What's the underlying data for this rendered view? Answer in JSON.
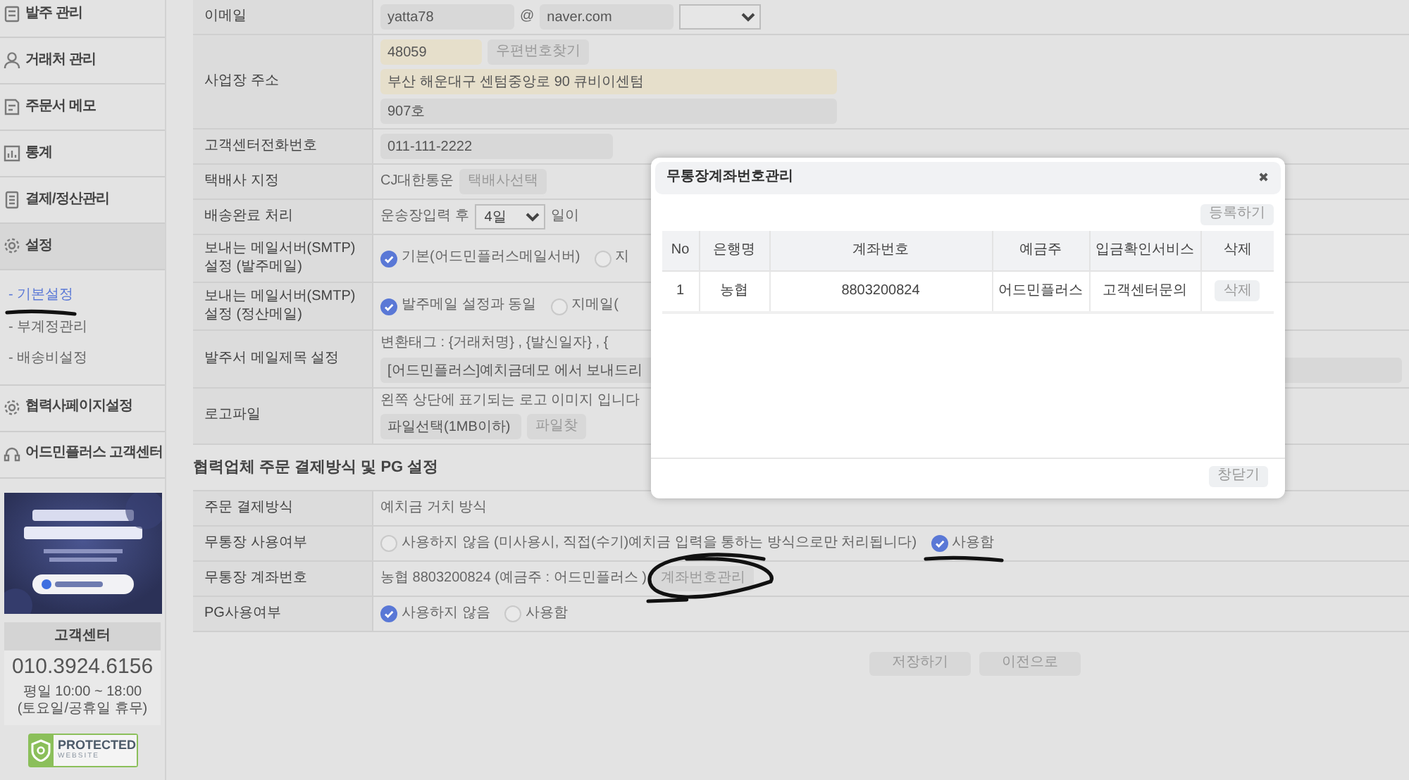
{
  "sidebar": {
    "menu": [
      {
        "label": "발주 관리",
        "expanded": false
      },
      {
        "label": "거래처 관리",
        "expanded": false
      },
      {
        "label": "주문서 메모",
        "expanded": false
      },
      {
        "label": "통계",
        "expanded": false
      },
      {
        "label": "결제/정산관리",
        "expanded": false
      },
      {
        "label": "설정",
        "expanded": true,
        "children": [
          {
            "label": "- 기본설정",
            "selected": true,
            "underlined": true
          },
          {
            "label": "- 부계정관리",
            "selected": false
          },
          {
            "label": "- 배송비설정",
            "selected": false
          }
        ]
      },
      {
        "label": "협력사페이지설정",
        "expanded": false
      },
      {
        "label": "어드민플러스 고객센터",
        "expanded": false
      }
    ],
    "support": {
      "title": "고객센터",
      "phone": "010.3924.6156",
      "hours": "평일 10:00 ~ 18:00",
      "note": "(토요일/공휴일 휴무)"
    },
    "badge": {
      "title": "PROTECTED",
      "subtitle": "WEBSITE"
    }
  },
  "form": {
    "rows": [
      {
        "label": "이메일",
        "lines": [
          [
            {
              "kind": "input",
              "value": "yatta78",
              "highlighted": false
            },
            {
              "kind": "text",
              "text": "@"
            },
            {
              "kind": "input",
              "value": "naver.com",
              "highlighted": false
            },
            {
              "kind": "select"
            }
          ]
        ]
      },
      {
        "label": "사업장 주소",
        "lines": [
          [
            {
              "kind": "input",
              "value": "48059",
              "highlighted": true
            },
            {
              "kind": "button",
              "label": "우편번호찾기"
            }
          ],
          [
            {
              "kind": "input",
              "value": "부산 해운대구 센텀중앙로 90 큐비이센텀",
              "highlighted": true
            }
          ],
          [
            {
              "kind": "input",
              "value": "907호",
              "highlighted": false
            }
          ]
        ]
      },
      {
        "label": "고객센터전화번호",
        "lines": [
          [
            {
              "kind": "input",
              "value": "011-111-2222",
              "highlighted": false
            }
          ]
        ]
      },
      {
        "label": "택배사 지정",
        "lines": [
          [
            {
              "kind": "text",
              "text": "CJ대한통운"
            },
            {
              "kind": "button",
              "label": "택배사선택"
            }
          ]
        ]
      },
      {
        "label": "배송완료 처리",
        "lines": [
          [
            {
              "kind": "text",
              "text": "운송장입력 후"
            },
            {
              "kind": "select",
              "value": "4일"
            },
            {
              "kind": "text",
              "text": "일이"
            }
          ]
        ]
      },
      {
        "label": "보내는 메일서버(SMTP) 설정 (발주메일)",
        "lines": [
          [
            {
              "kind": "radio",
              "label": "기본(어드민플러스메일서버)",
              "selected": true
            },
            {
              "kind": "radio",
              "label": "지",
              "selected": false
            }
          ]
        ]
      },
      {
        "label": "보내는 메일서버(SMTP) 설정 (정산메일)",
        "lines": [
          [
            {
              "kind": "radio",
              "label": "발주메일 설정과 동일",
              "selected": true
            },
            {
              "kind": "radio",
              "label": "지메일(",
              "selected": false
            }
          ]
        ]
      },
      {
        "label": "발주서 메일제목 설정",
        "lines": [
          [
            {
              "kind": "text",
              "text": "변환태그 : {거래처명} , {발신일자} , {"
            }
          ],
          [
            {
              "kind": "input",
              "value": "[어드민플러스]예치금데모 에서 보내드리",
              "highlighted": false
            }
          ]
        ]
      },
      {
        "label": "로고파일",
        "lines": [
          [
            {
              "kind": "text",
              "text": "왼쪽 상단에 표기되는 로고 이미지 입니다"
            }
          ],
          [
            {
              "kind": "input",
              "value": "파일선택(1MB이하)",
              "highlighted": false
            },
            {
              "kind": "button",
              "label": "파일찾"
            }
          ]
        ]
      }
    ]
  },
  "payment": {
    "title": "협력업체 주문 결제방식 및 PG 설정",
    "rows": [
      {
        "label": "주문 결제방식",
        "lines": [
          [
            {
              "kind": "text",
              "text": "예치금 거치 방식"
            }
          ]
        ]
      },
      {
        "label": "무통장 사용여부",
        "lines": [
          [
            {
              "kind": "radio",
              "label": "사용하지 않음 (미사용시, 직접(수기)예치금 입력을 통하는 방식으로만 처리됩니다)",
              "selected": false
            },
            {
              "kind": "radio",
              "label": "사용함",
              "selected": true,
              "underlined": true
            }
          ]
        ]
      },
      {
        "label": "무통장 계좌번호",
        "lines": [
          [
            {
              "kind": "text",
              "text": "농협 8803200824 (예금주 : 어드민플러스 )"
            },
            {
              "kind": "button",
              "label": "계좌번호관리",
              "circled": true
            }
          ]
        ]
      },
      {
        "label": "PG사용여부",
        "lines": [
          [
            {
              "kind": "radio",
              "label": "사용하지 않음",
              "selected": true
            },
            {
              "kind": "radio",
              "label": "사용함",
              "selected": false
            }
          ]
        ]
      }
    ]
  },
  "buttons": [
    "저장하기",
    "이전으로"
  ],
  "modal": {
    "title": "무통장계좌번호관리",
    "close": "✖",
    "register": "등록하기",
    "columns": [
      "No",
      "은행명",
      "계좌번호",
      "예금주",
      "입금확인서비스",
      "삭제"
    ],
    "rows": [
      {
        "cells": [
          "1",
          "농협",
          "8803200824",
          "어드민플러스",
          "고객센터문의"
        ],
        "action": "삭제"
      }
    ],
    "footer_button": "창닫기"
  }
}
